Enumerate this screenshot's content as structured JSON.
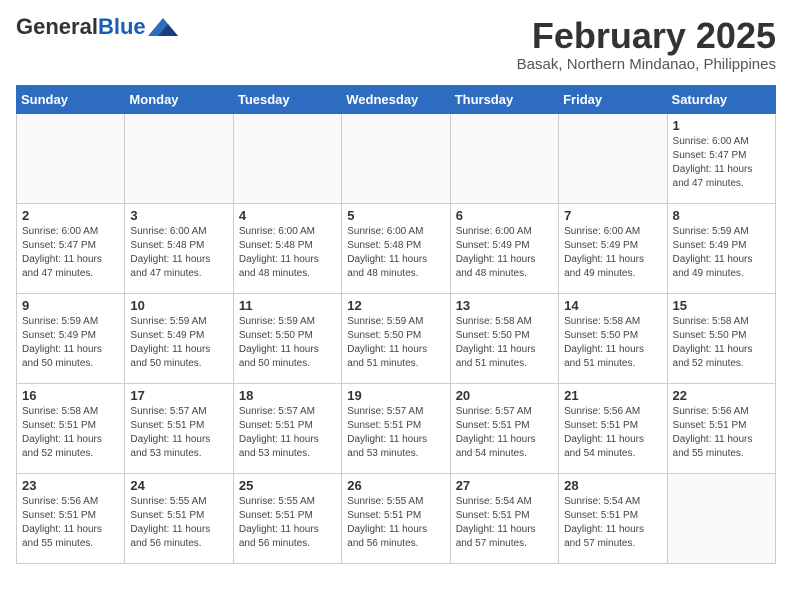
{
  "header": {
    "logo_general": "General",
    "logo_blue": "Blue",
    "month_title": "February 2025",
    "location": "Basak, Northern Mindanao, Philippines"
  },
  "weekdays": [
    "Sunday",
    "Monday",
    "Tuesday",
    "Wednesday",
    "Thursday",
    "Friday",
    "Saturday"
  ],
  "weeks": [
    [
      {
        "day": "",
        "info": ""
      },
      {
        "day": "",
        "info": ""
      },
      {
        "day": "",
        "info": ""
      },
      {
        "day": "",
        "info": ""
      },
      {
        "day": "",
        "info": ""
      },
      {
        "day": "",
        "info": ""
      },
      {
        "day": "1",
        "info": "Sunrise: 6:00 AM\nSunset: 5:47 PM\nDaylight: 11 hours\nand 47 minutes."
      }
    ],
    [
      {
        "day": "2",
        "info": "Sunrise: 6:00 AM\nSunset: 5:47 PM\nDaylight: 11 hours\nand 47 minutes."
      },
      {
        "day": "3",
        "info": "Sunrise: 6:00 AM\nSunset: 5:48 PM\nDaylight: 11 hours\nand 47 minutes."
      },
      {
        "day": "4",
        "info": "Sunrise: 6:00 AM\nSunset: 5:48 PM\nDaylight: 11 hours\nand 48 minutes."
      },
      {
        "day": "5",
        "info": "Sunrise: 6:00 AM\nSunset: 5:48 PM\nDaylight: 11 hours\nand 48 minutes."
      },
      {
        "day": "6",
        "info": "Sunrise: 6:00 AM\nSunset: 5:49 PM\nDaylight: 11 hours\nand 48 minutes."
      },
      {
        "day": "7",
        "info": "Sunrise: 6:00 AM\nSunset: 5:49 PM\nDaylight: 11 hours\nand 49 minutes."
      },
      {
        "day": "8",
        "info": "Sunrise: 5:59 AM\nSunset: 5:49 PM\nDaylight: 11 hours\nand 49 minutes."
      }
    ],
    [
      {
        "day": "9",
        "info": "Sunrise: 5:59 AM\nSunset: 5:49 PM\nDaylight: 11 hours\nand 50 minutes."
      },
      {
        "day": "10",
        "info": "Sunrise: 5:59 AM\nSunset: 5:49 PM\nDaylight: 11 hours\nand 50 minutes."
      },
      {
        "day": "11",
        "info": "Sunrise: 5:59 AM\nSunset: 5:50 PM\nDaylight: 11 hours\nand 50 minutes."
      },
      {
        "day": "12",
        "info": "Sunrise: 5:59 AM\nSunset: 5:50 PM\nDaylight: 11 hours\nand 51 minutes."
      },
      {
        "day": "13",
        "info": "Sunrise: 5:58 AM\nSunset: 5:50 PM\nDaylight: 11 hours\nand 51 minutes."
      },
      {
        "day": "14",
        "info": "Sunrise: 5:58 AM\nSunset: 5:50 PM\nDaylight: 11 hours\nand 51 minutes."
      },
      {
        "day": "15",
        "info": "Sunrise: 5:58 AM\nSunset: 5:50 PM\nDaylight: 11 hours\nand 52 minutes."
      }
    ],
    [
      {
        "day": "16",
        "info": "Sunrise: 5:58 AM\nSunset: 5:51 PM\nDaylight: 11 hours\nand 52 minutes."
      },
      {
        "day": "17",
        "info": "Sunrise: 5:57 AM\nSunset: 5:51 PM\nDaylight: 11 hours\nand 53 minutes."
      },
      {
        "day": "18",
        "info": "Sunrise: 5:57 AM\nSunset: 5:51 PM\nDaylight: 11 hours\nand 53 minutes."
      },
      {
        "day": "19",
        "info": "Sunrise: 5:57 AM\nSunset: 5:51 PM\nDaylight: 11 hours\nand 53 minutes."
      },
      {
        "day": "20",
        "info": "Sunrise: 5:57 AM\nSunset: 5:51 PM\nDaylight: 11 hours\nand 54 minutes."
      },
      {
        "day": "21",
        "info": "Sunrise: 5:56 AM\nSunset: 5:51 PM\nDaylight: 11 hours\nand 54 minutes."
      },
      {
        "day": "22",
        "info": "Sunrise: 5:56 AM\nSunset: 5:51 PM\nDaylight: 11 hours\nand 55 minutes."
      }
    ],
    [
      {
        "day": "23",
        "info": "Sunrise: 5:56 AM\nSunset: 5:51 PM\nDaylight: 11 hours\nand 55 minutes."
      },
      {
        "day": "24",
        "info": "Sunrise: 5:55 AM\nSunset: 5:51 PM\nDaylight: 11 hours\nand 56 minutes."
      },
      {
        "day": "25",
        "info": "Sunrise: 5:55 AM\nSunset: 5:51 PM\nDaylight: 11 hours\nand 56 minutes."
      },
      {
        "day": "26",
        "info": "Sunrise: 5:55 AM\nSunset: 5:51 PM\nDaylight: 11 hours\nand 56 minutes."
      },
      {
        "day": "27",
        "info": "Sunrise: 5:54 AM\nSunset: 5:51 PM\nDaylight: 11 hours\nand 57 minutes."
      },
      {
        "day": "28",
        "info": "Sunrise: 5:54 AM\nSunset: 5:51 PM\nDaylight: 11 hours\nand 57 minutes."
      },
      {
        "day": "",
        "info": ""
      }
    ]
  ]
}
